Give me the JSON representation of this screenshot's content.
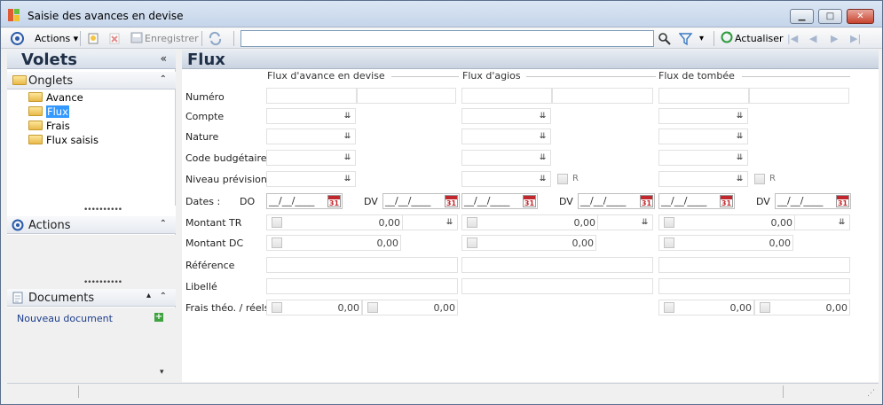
{
  "window": {
    "title": "Saisie des avances en devise",
    "minimize": "▁",
    "restore": "□",
    "close": "✕"
  },
  "toolbar": {
    "actions_label": "Actions",
    "save_label": "Enregistrer",
    "search_value": "",
    "refresh_label": "Actualiser"
  },
  "left": {
    "volets_title": "Volets",
    "onglets": {
      "title": "Onglets",
      "items": [
        "Avance",
        "Flux",
        "Frais",
        "Flux saisis"
      ],
      "selected": "Flux"
    },
    "actions_title": "Actions",
    "documents": {
      "title": "Documents",
      "new_doc": "Nouveau document"
    }
  },
  "main": {
    "title": "Flux",
    "sections": [
      "Flux d'avance en devise",
      "Flux d'agios",
      "Flux de tombée"
    ],
    "labels": {
      "numero": "Numéro",
      "compte": "Compte",
      "nature": "Nature",
      "code_budgetaire": "Code budgétaire",
      "niveau_prevision": "Niveau prévision",
      "dates": "Dates :",
      "montant_tr": "Montant TR",
      "montant_dc": "Montant DC",
      "reference": "Référence",
      "libelle": "Libellé",
      "frais": "Frais théo. / réels"
    },
    "do_label": "DO",
    "dv_label": "DV",
    "r_label": "R",
    "date_placeholder": "__/__/____",
    "cal_day": "31",
    "zero": "0,00"
  },
  "colors": {
    "accent": "#1f3048",
    "calendar": "#c1272d"
  }
}
